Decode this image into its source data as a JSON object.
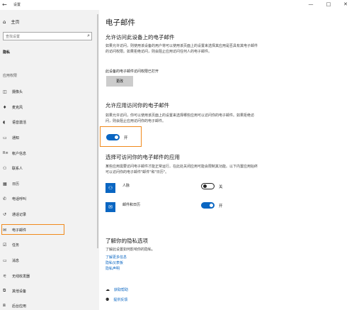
{
  "window": {
    "back": "←",
    "title": "设置",
    "minimize": "—",
    "maximize": "□",
    "close": "✕"
  },
  "sidebar": {
    "home": "主页",
    "search_placeholder": "查找设置",
    "category": "隐私",
    "section": "应用权限",
    "items": [
      {
        "label": "摄像头",
        "icon": "camera-icon"
      },
      {
        "label": "麦克风",
        "icon": "microphone-icon"
      },
      {
        "label": "语音激活",
        "icon": "voice-icon"
      },
      {
        "label": "通知",
        "icon": "notification-icon"
      },
      {
        "label": "帐户信息",
        "icon": "account-info-icon"
      },
      {
        "label": "联系人",
        "icon": "contacts-icon"
      },
      {
        "label": "日历",
        "icon": "calendar-icon"
      },
      {
        "label": "电话呼叫",
        "icon": "phone-icon"
      },
      {
        "label": "通话记录",
        "icon": "call-history-icon"
      },
      {
        "label": "电子邮件",
        "icon": "email-icon"
      },
      {
        "label": "任务",
        "icon": "tasks-icon"
      },
      {
        "label": "消息",
        "icon": "messaging-icon"
      },
      {
        "label": "无线收发器",
        "icon": "radios-icon"
      },
      {
        "label": "其他设备",
        "icon": "other-devices-icon"
      },
      {
        "label": "后台应用",
        "icon": "background-apps-icon"
      }
    ],
    "highlight_color": "#f08a1c"
  },
  "main": {
    "title": "电子邮件",
    "device_section": {
      "heading": "允许访问此设备上的电子邮件",
      "description": "如果允许访问，则使用该设备的用户将可以使用该页面上的设置来选择其应用是否具有其电子邮件的访问权限。如果拒绝访问，则会阻止应用访问任何人的电子邮件。",
      "status": "此设备的电子邮件访问权限已打开",
      "change_button": "更改"
    },
    "apps_section": {
      "heading": "允许应用访问你的电子邮件",
      "description": "如果允许访问，你可以使用该页面上的设置来选择哪些应用可以访问你的电子邮件。如果拒绝访问，则会阻止应用访问你的电子邮件。",
      "toggle_label": "开",
      "toggle_on": true
    },
    "choose_section": {
      "heading": "选择可访问你的电子邮件的应用",
      "description": "某些应用需要访问电子邮件才能正常运行。在此处关闭应用可能会限制其功能。以下内置应用始终可以访问你的电子邮件\"邮件\"和\"日历\"。",
      "apps": [
        {
          "name": "人脉",
          "icon": "people-app-icon",
          "state_label": "关",
          "on": false
        },
        {
          "name": "邮件和日历",
          "icon": "mail-calendar-app-icon",
          "state_label": "开",
          "on": true
        }
      ]
    },
    "learn_section": {
      "heading": "了解你的隐私选项",
      "description": "了解此设置如何影响你的隐私。",
      "links": [
        "了解更多信息",
        "隐私仪表板",
        "隐私声明"
      ]
    },
    "help": [
      {
        "label": "获取帮助",
        "icon": "help-icon"
      },
      {
        "label": "提供反馈",
        "icon": "feedback-icon"
      }
    ],
    "accent_color": "#0a66c2"
  }
}
